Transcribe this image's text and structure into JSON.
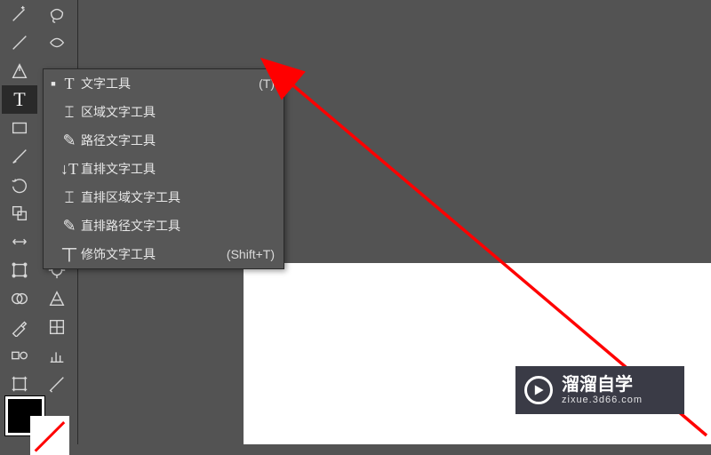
{
  "toolbar": {
    "tools_left": [
      "magic-wand",
      "line-segment",
      "pen",
      "type",
      "rectangle",
      "brush",
      "rotate",
      "scale",
      "width",
      "free-transform",
      "warp",
      "eyedropper",
      "blend",
      "artboard",
      "hand"
    ],
    "tools_right": [
      "lasso",
      "arc",
      "anchor-add",
      "gradient",
      "ellipse",
      "pencil",
      "mirror",
      "shear",
      "puppet",
      "wrinkle",
      "envelope",
      "measure",
      "graph",
      "slice",
      "zoom"
    ],
    "selected": "type"
  },
  "flyout": {
    "items": [
      {
        "icon": "T",
        "label": "文字工具",
        "shortcut": "(T)",
        "selected": true
      },
      {
        "icon": "⌶",
        "label": "区域文字工具",
        "shortcut": "",
        "selected": false
      },
      {
        "icon": "✎",
        "label": "路径文字工具",
        "shortcut": "",
        "selected": false
      },
      {
        "icon": "↓T",
        "label": "直排文字工具",
        "shortcut": "",
        "selected": false
      },
      {
        "icon": "⌶",
        "label": "直排区域文字工具",
        "shortcut": "",
        "selected": false
      },
      {
        "icon": "✎",
        "label": "直排路径文字工具",
        "shortcut": "",
        "selected": false
      },
      {
        "icon": "丅",
        "label": "修饰文字工具",
        "shortcut": "(Shift+T)",
        "selected": false
      }
    ]
  },
  "watermark": {
    "line1": "溜溜自学",
    "line2": "zixue.3d66.com"
  },
  "annotation": {
    "arrow_color": "#ff0000"
  }
}
